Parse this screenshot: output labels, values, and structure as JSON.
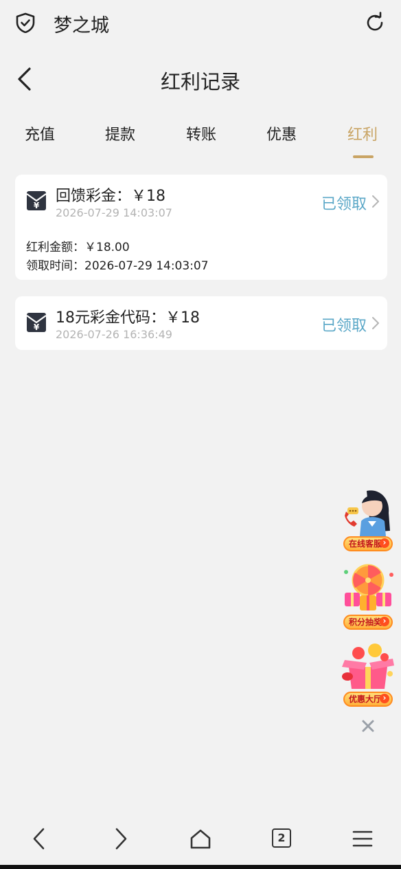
{
  "browser": {
    "title": "梦之城",
    "icons": [
      "shield-icon",
      "refresh-icon"
    ]
  },
  "header": {
    "title": "红利记录",
    "back_icon": "chevron-left-icon"
  },
  "tabs": [
    {
      "label": "充值",
      "active": false
    },
    {
      "label": "提款",
      "active": false
    },
    {
      "label": "转账",
      "active": false
    },
    {
      "label": "优惠",
      "active": false
    },
    {
      "label": "红利",
      "active": true
    }
  ],
  "records": [
    {
      "title": "回馈彩金：￥18",
      "date": "2026-07-29 14:03:07",
      "status": "已领取",
      "details": [
        "红利金额：￥18.00",
        "领取时间：2026-07-29 14:03:07"
      ]
    },
    {
      "title": "18元彩金代码：￥18",
      "date": "2026-07-26 16:36:49",
      "status": "已领取"
    }
  ],
  "float_widgets": [
    {
      "label": "在线客服",
      "icon": "customer-service-icon"
    },
    {
      "label": "积分抽奖",
      "icon": "lucky-wheel-icon"
    },
    {
      "label": "优惠大厅",
      "icon": "gift-box-icon"
    }
  ],
  "bottom_nav": {
    "tab_count": "2",
    "icons": [
      "back-icon",
      "forward-icon",
      "home-icon",
      "tabs-icon",
      "menu-icon"
    ]
  },
  "colors": {
    "accent": "#c9a464",
    "status": "#5aa7c7",
    "background": "#f2f2f2"
  }
}
